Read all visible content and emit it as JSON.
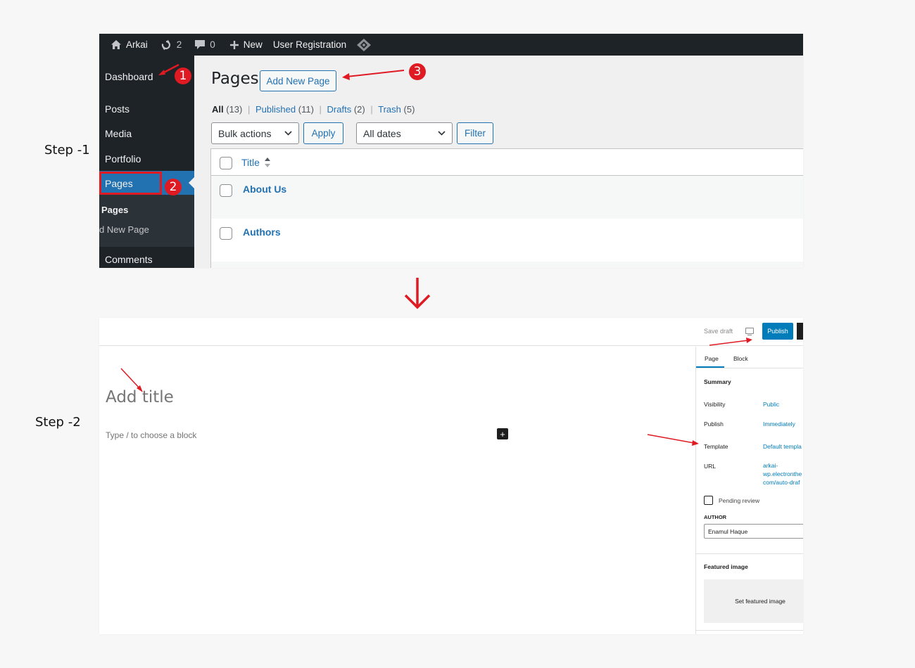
{
  "labels": {
    "step1": "Step -1",
    "step2": "Step -2"
  },
  "colors": {
    "wp_dark": "#1d2327",
    "wp_blue": "#2271b1",
    "annotation_red": "#e01a22",
    "gutenberg_blue": "#007cba"
  },
  "step1": {
    "admin_bar": {
      "site_name": "Arkai",
      "updates_count": "2",
      "comments_count": "0",
      "new_label": "New",
      "plugin_label": "User Registration",
      "icons": [
        "home-icon",
        "updates-icon",
        "comment-icon",
        "plus-icon",
        "diamond-icon"
      ]
    },
    "sidebar": {
      "dashboard": "Dashboard",
      "posts": "Posts",
      "media": "Media",
      "portfolio": "Portfolio",
      "pages": "Pages",
      "sub_pages": "Pages",
      "sub_add_new": "d New Page",
      "comments": "Comments"
    },
    "main": {
      "title": "Pages",
      "add_new": "Add New Page",
      "filters": {
        "all": "All",
        "all_count": "(13)",
        "published": "Published",
        "published_count": "(11)",
        "drafts": "Drafts",
        "drafts_count": "(2)",
        "trash": "Trash",
        "trash_count": "(5)",
        "separator": "|"
      },
      "bulk_actions": "Bulk actions",
      "apply": "Apply",
      "all_dates": "All dates",
      "filter": "Filter",
      "column_title": "Title",
      "rows": [
        "About Us",
        "Authors"
      ]
    },
    "badges": {
      "one": "1",
      "two": "2",
      "three": "3"
    }
  },
  "step2": {
    "toolbar": {
      "save_draft": "Save draft",
      "publish": "Publish"
    },
    "editor": {
      "title_placeholder": "Add title",
      "block_hint": "Type / to choose a block",
      "add_block": "+"
    },
    "panel": {
      "tab_page": "Page",
      "tab_block": "Block",
      "summary": "Summary",
      "visibility_label": "Visibility",
      "visibility_value": "Public",
      "publish_label": "Publish",
      "publish_value": "Immediately",
      "template_label": "Template",
      "template_value": "Default templa",
      "url_label": "URL",
      "url_line1": "arkai-",
      "url_line2": "wp.electronthe",
      "url_line3": "com/auto-draf",
      "pending_review": "Pending review",
      "author_label": "AUTHOR",
      "author_value": "Enamul Haque",
      "featured_image": "Featured image",
      "set_featured": "Set featured image"
    }
  }
}
